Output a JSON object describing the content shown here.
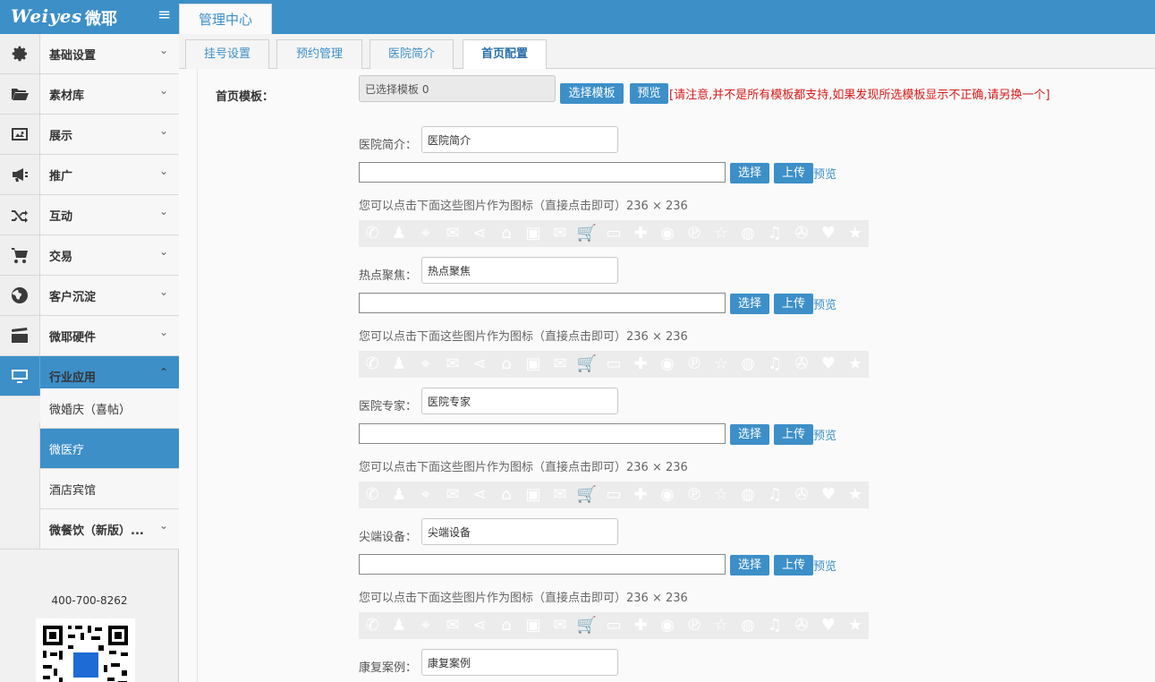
{
  "header": {
    "logo_text": "Weiyes",
    "logo_cn": "微耶",
    "menu_toggle": "≡",
    "main_tab": "管理中心"
  },
  "sidebar": {
    "items": [
      {
        "label": "基础设置",
        "icon": "gear-icon"
      },
      {
        "label": "素材库",
        "icon": "folder-open-icon"
      },
      {
        "label": "展示",
        "icon": "image-icon"
      },
      {
        "label": "推广",
        "icon": "megaphone-icon"
      },
      {
        "label": "互动",
        "icon": "shuffle-icon"
      },
      {
        "label": "交易",
        "icon": "cart-icon"
      },
      {
        "label": "客户沉淀",
        "icon": "globe-icon"
      },
      {
        "label": "微耶硬件",
        "icon": "clapperboard-icon"
      },
      {
        "label": "行业应用",
        "icon": "monitor-icon"
      },
      {
        "label": "微餐饮（新版）...",
        "icon": "cube-icon"
      }
    ],
    "subitems": [
      {
        "label": "微婚庆（喜帖）"
      },
      {
        "label": "微医疗"
      },
      {
        "label": "酒店宾馆"
      }
    ],
    "chevron_down": "⌄",
    "chevron_up": "⌃",
    "phone": "400-700-8262"
  },
  "subtabs": [
    "挂号设置",
    "预约管理",
    "医院简介",
    "首页配置"
  ],
  "form": {
    "template_label": "首页模板：",
    "template_value": "已选择模板 0",
    "select_template_btn": "选择模板",
    "preview_btn": "预览",
    "warning": "[请注意,并不是所有模板都支持,如果发现所选模板显示不正确,请另换一个]",
    "select_btn": "选择",
    "upload_btn": "上传",
    "preview_link": "预览",
    "hint": "您可以点击下面这些图片作为图标（直接点击即可）236 × 236",
    "sections": [
      {
        "label": "医院简介：",
        "value": "医院简介"
      },
      {
        "label": "热点聚焦：",
        "value": "热点聚焦"
      },
      {
        "label": "医院专家：",
        "value": "医院专家"
      },
      {
        "label": "尖端设备：",
        "value": "尖端设备"
      },
      {
        "label": "康复案例：",
        "value": "康复案例"
      }
    ]
  },
  "icon_strip": [
    "phone-icon",
    "user-icon",
    "map-pin-icon",
    "chat-icon",
    "share-icon",
    "home-icon",
    "picture-icon",
    "mail-icon",
    "cart-icon",
    "card-icon",
    "gift-icon",
    "weibo-icon",
    "p-icon",
    "star-outline-icon",
    "wechat-icon",
    "music-icon",
    "film-icon",
    "heart-icon",
    "star-icon"
  ],
  "icon_glyphs": [
    "✆",
    "♟",
    "⌖",
    "✉",
    "⋖",
    "⌂",
    "▣",
    "✉",
    "🛒",
    "▭",
    "✚",
    "◉",
    "℗",
    "☆",
    "◍",
    "♫",
    "✇",
    "♥",
    "★"
  ]
}
